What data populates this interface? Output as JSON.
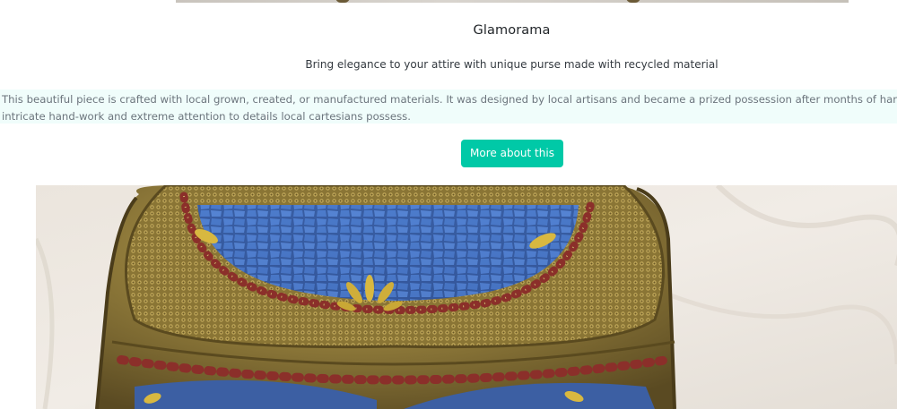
{
  "product": {
    "title": "Glamorama",
    "subtitle": "Bring elegance to your attire with unique purse made with recycled material",
    "description_line_1": "This beautiful piece is crafted with local grown, created, or manufactured materials. It was designed by local artisans and became a prized possession after months of hard work. This",
    "description_line_2": "intricate hand-work and extreme attention to details local cartesians possess.",
    "more_button_label": "More about this"
  },
  "colors": {
    "accent": "#00c9a7",
    "description_background": "#f0fdfb",
    "muted_text": "#6c757d"
  }
}
